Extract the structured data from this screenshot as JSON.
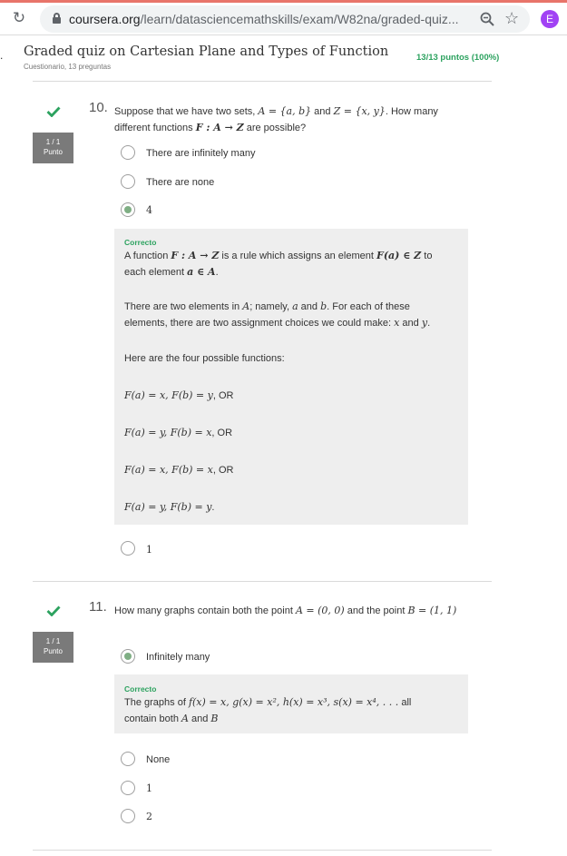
{
  "browser": {
    "url_host": "coursera.org",
    "url_path": "/learn/datasciencemathskills/exam/W82na/graded-quiz...",
    "avatar_letter": "E"
  },
  "header": {
    "title": "Graded quiz on Cartesian Plane and Types of Function",
    "subtitle": "Cuestionario, 13 preguntas",
    "score": "13/13 puntos (100%)"
  },
  "q10": {
    "number": "10.",
    "badge_score": "1 / 1",
    "badge_label": "Punto",
    "text_l1_a": "Suppose that we have two sets, ",
    "text_l1_m1": "A = {a, b}",
    "text_l1_b": " and ",
    "text_l1_m2": "Z = {x, y}",
    "text_l1_c": ". How many",
    "text_l2_a": "different functions ",
    "text_l2_m": "F : A → Z",
    "text_l2_b": " are possible?",
    "options": [
      "There are infinitely many",
      "There are none",
      "4",
      "1"
    ],
    "feedback": {
      "status": "Correcto",
      "p1_a": "A function ",
      "p1_m1": "F : A → Z",
      "p1_b": " is a rule which assigns an element ",
      "p1_m2": "F(a) ∈ Z",
      "p1_c": " to",
      "p1_d": "each element ",
      "p1_m3": "a ∈ A",
      "p1_e": ".",
      "p2_a": "There are two elements in ",
      "p2_m1": "A",
      "p2_b": "; namely, ",
      "p2_m2": "a",
      "p2_c": " and ",
      "p2_m3": "b",
      "p2_d": ". For each of these",
      "p2_e": "elements, there are two assignment choices we could make: ",
      "p2_m4": "x",
      "p2_f": " and ",
      "p2_m5": "y",
      "p2_g": ".",
      "p3": "Here are the four possible functions:",
      "f1_m": "F(a) = x, F(b) = y",
      "f1_t": ", OR",
      "f2_m": "F(a) = y, F(b) = x",
      "f2_t": ", OR",
      "f3_m": "F(a) = x, F(b) = x",
      "f3_t": ", OR",
      "f4_m": "F(a) = y, F(b) = y",
      "f4_t": "."
    }
  },
  "q11": {
    "number": "11.",
    "badge_score": "1 / 1",
    "badge_label": "Punto",
    "text_a": "How many graphs contain both the point ",
    "text_m1": "A = (0, 0)",
    "text_b": " and the point ",
    "text_m2": "B = (1, 1)",
    "options": [
      "Infinitely many",
      "None",
      "1",
      "2"
    ],
    "feedback": {
      "status": "Correcto",
      "l1_a": "The graphs of ",
      "l1_m": "f(x) = x, g(x) = x², h(x) = x³, s(x) = x⁴, . . .",
      "l1_b": " all",
      "l2_a": "contain both ",
      "l2_m1": "A",
      "l2_b": " and ",
      "l2_m2": "B"
    }
  },
  "colors": {
    "accent_green": "#2ca25f",
    "badge_gray": "#7a7a7a",
    "feedback_bg": "#eeeeee",
    "avatar_purple": "#a142f4"
  }
}
